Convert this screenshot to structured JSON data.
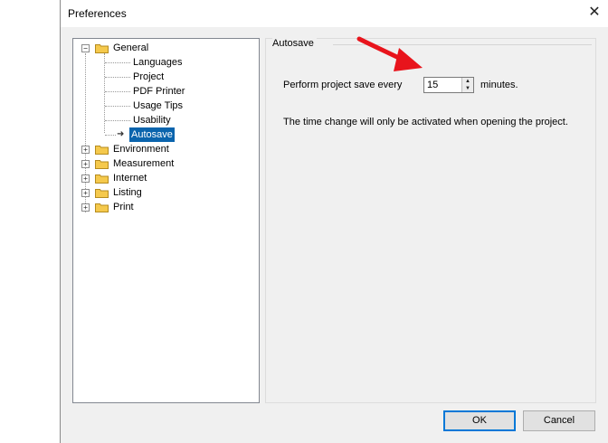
{
  "window": {
    "title": "Preferences",
    "close_glyph": "✕"
  },
  "tree": {
    "nodes": [
      {
        "label": "General",
        "expander": "−",
        "icon": "folder-icon"
      },
      {
        "label": "Languages"
      },
      {
        "label": "Project"
      },
      {
        "label": "PDF Printer"
      },
      {
        "label": "Usage Tips"
      },
      {
        "label": "Usability"
      },
      {
        "label": "Autosave",
        "selected": true,
        "icon": "arrow-right-icon"
      },
      {
        "label": "Environment",
        "expander": "+",
        "icon": "folder-icon"
      },
      {
        "label": "Measurement",
        "expander": "+",
        "icon": "folder-icon"
      },
      {
        "label": "Internet",
        "expander": "+",
        "icon": "folder-icon"
      },
      {
        "label": "Listing",
        "expander": "+",
        "icon": "folder-icon"
      },
      {
        "label": "Print",
        "expander": "+",
        "icon": "folder-icon"
      }
    ]
  },
  "autosave": {
    "group_title": "Autosave",
    "save_label": "Perform project save every",
    "interval_value": "15",
    "unit_label": "minutes.",
    "note": "The time change will only be activated when opening the project."
  },
  "buttons": {
    "ok": "OK",
    "cancel": "Cancel"
  },
  "colors": {
    "selection": "#0a64ad",
    "annotation_arrow": "#e8141c",
    "folder": "#f5c94c"
  }
}
